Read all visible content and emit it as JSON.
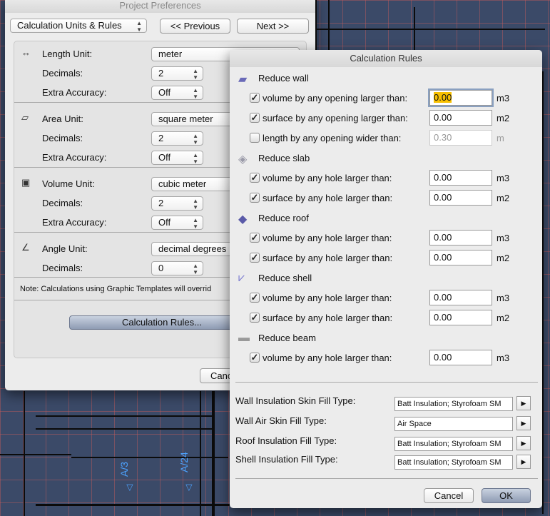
{
  "background": {
    "tags": [
      "A/3",
      "A/24"
    ]
  },
  "prefs": {
    "title": "Project Preferences",
    "page_popup": "Calculation Units & Rules",
    "previous": "<< Previous",
    "next": "Next >>",
    "rows": [
      {
        "icon": "length-unit-icon",
        "label": "Length Unit:",
        "value": "meter",
        "wide": true
      },
      {
        "label": "Decimals:",
        "value": "2"
      },
      {
        "label": "Extra Accuracy:",
        "value": "Off"
      },
      {
        "icon": "area-unit-icon",
        "label": "Area Unit:",
        "value": "square meter",
        "wide": true
      },
      {
        "label": "Decimals:",
        "value": "2"
      },
      {
        "label": "Extra Accuracy:",
        "value": "Off"
      },
      {
        "icon": "volume-unit-icon",
        "label": "Volume Unit:",
        "value": "cubic meter",
        "wide": true
      },
      {
        "label": "Decimals:",
        "value": "2"
      },
      {
        "label": "Extra Accuracy:",
        "value": "Off"
      },
      {
        "icon": "angle-unit-icon",
        "label": "Angle Unit:",
        "value": "decimal degrees",
        "wide": true
      },
      {
        "label": "Decimals:",
        "value": "0"
      }
    ],
    "note": "Note: Calculations using Graphic Templates will overrid",
    "calc_rules_button": "Calculation Rules...",
    "cancel": "Cancel"
  },
  "rules": {
    "title": "Calculation Rules",
    "sections": [
      {
        "icon": "wall-icon",
        "label": "Reduce wall",
        "color": "#6a6ab8",
        "items": [
          {
            "checked": true,
            "label": "volume by any opening larger than:",
            "value": "0.00",
            "unit": "m3",
            "focused": true
          },
          {
            "checked": true,
            "label": "surface by any opening larger than:",
            "value": "0.00",
            "unit": "m2"
          },
          {
            "checked": false,
            "label": "length by any opening wider than:",
            "value": "0.30",
            "unit": "m",
            "disabled": true
          }
        ]
      },
      {
        "icon": "slab-icon",
        "label": "Reduce slab",
        "color": "#9a9aa8",
        "items": [
          {
            "checked": true,
            "label": "volume by any hole larger than:",
            "value": "0.00",
            "unit": "m3"
          },
          {
            "checked": true,
            "label": "surface by any hole larger than:",
            "value": "0.00",
            "unit": "m2"
          }
        ]
      },
      {
        "icon": "roof-icon",
        "label": "Reduce roof",
        "color": "#5a5aa8",
        "items": [
          {
            "checked": true,
            "label": "volume by any hole larger than:",
            "value": "0.00",
            "unit": "m3"
          },
          {
            "checked": true,
            "label": "surface by any hole larger than:",
            "value": "0.00",
            "unit": "m2"
          }
        ]
      },
      {
        "icon": "shell-icon",
        "label": "Reduce shell",
        "color": "#7a7ad0",
        "items": [
          {
            "checked": true,
            "label": "volume by any hole larger than:",
            "value": "0.00",
            "unit": "m3"
          },
          {
            "checked": true,
            "label": "surface by any hole larger than:",
            "value": "0.00",
            "unit": "m2"
          }
        ]
      },
      {
        "icon": "beam-icon",
        "label": "Reduce beam",
        "color": "#999999",
        "items": [
          {
            "checked": true,
            "label": "volume by any hole larger than:",
            "value": "0.00",
            "unit": "m3"
          }
        ]
      }
    ],
    "fills": [
      {
        "label": "Wall Insulation Skin Fill Type:",
        "value": "Batt Insulation; Styrofoam SM"
      },
      {
        "label": "Wall Air Skin Fill Type:",
        "value": "Air Space"
      },
      {
        "label": "Roof Insulation Fill Type:",
        "value": "Batt Insulation; Styrofoam SM"
      },
      {
        "label": "Shell Insulation Fill Type:",
        "value": "Batt Insulation; Styrofoam SM"
      }
    ],
    "cancel": "Cancel",
    "ok": "OK"
  }
}
